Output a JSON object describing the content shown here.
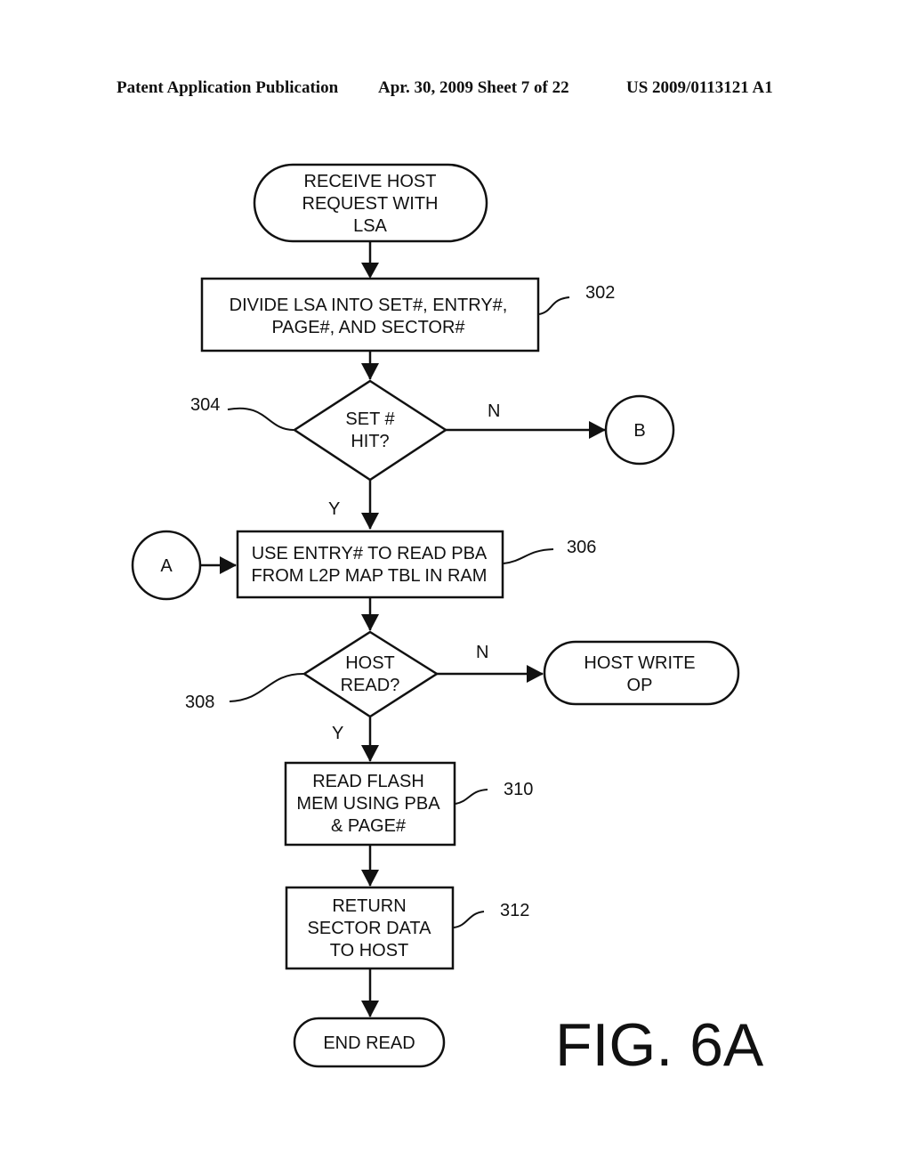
{
  "header": {
    "left": "Patent Application Publication",
    "middle": "Apr. 30, 2009  Sheet 7 of 22",
    "right": "US 2009/0113121 A1"
  },
  "figure_label": "FIG. 6A",
  "nodes": {
    "start": {
      "type": "terminal",
      "lines": [
        "RECEIVE HOST",
        "REQUEST WITH",
        "LSA"
      ]
    },
    "n302": {
      "type": "process",
      "ref": "302",
      "lines": [
        "DIVIDE LSA INTO SET#, ENTRY#,",
        "PAGE#, AND SECTOR#"
      ]
    },
    "n304": {
      "type": "decision",
      "ref": "304",
      "lines": [
        "SET #",
        "HIT?"
      ]
    },
    "connB": {
      "type": "connector",
      "lines": [
        "B"
      ]
    },
    "connA": {
      "type": "connector",
      "lines": [
        "A"
      ]
    },
    "n306": {
      "type": "process",
      "ref": "306",
      "lines": [
        "USE ENTRY# TO READ PBA",
        "FROM L2P MAP TBL IN RAM"
      ]
    },
    "n308": {
      "type": "decision",
      "ref": "308",
      "lines": [
        "HOST",
        "READ?"
      ]
    },
    "write": {
      "type": "terminal",
      "lines": [
        "HOST WRITE",
        "OP"
      ]
    },
    "n310": {
      "type": "process",
      "ref": "310",
      "lines": [
        "READ FLASH",
        "MEM USING PBA",
        "& PAGE#"
      ]
    },
    "n312": {
      "type": "process",
      "ref": "312",
      "lines": [
        "RETURN",
        "SECTOR DATA",
        "TO HOST"
      ]
    },
    "end": {
      "type": "terminal",
      "lines": [
        "END READ"
      ]
    }
  },
  "edge_labels": {
    "n304_no": "N",
    "n304_yes": "Y",
    "n308_no": "N",
    "n308_yes": "Y"
  }
}
